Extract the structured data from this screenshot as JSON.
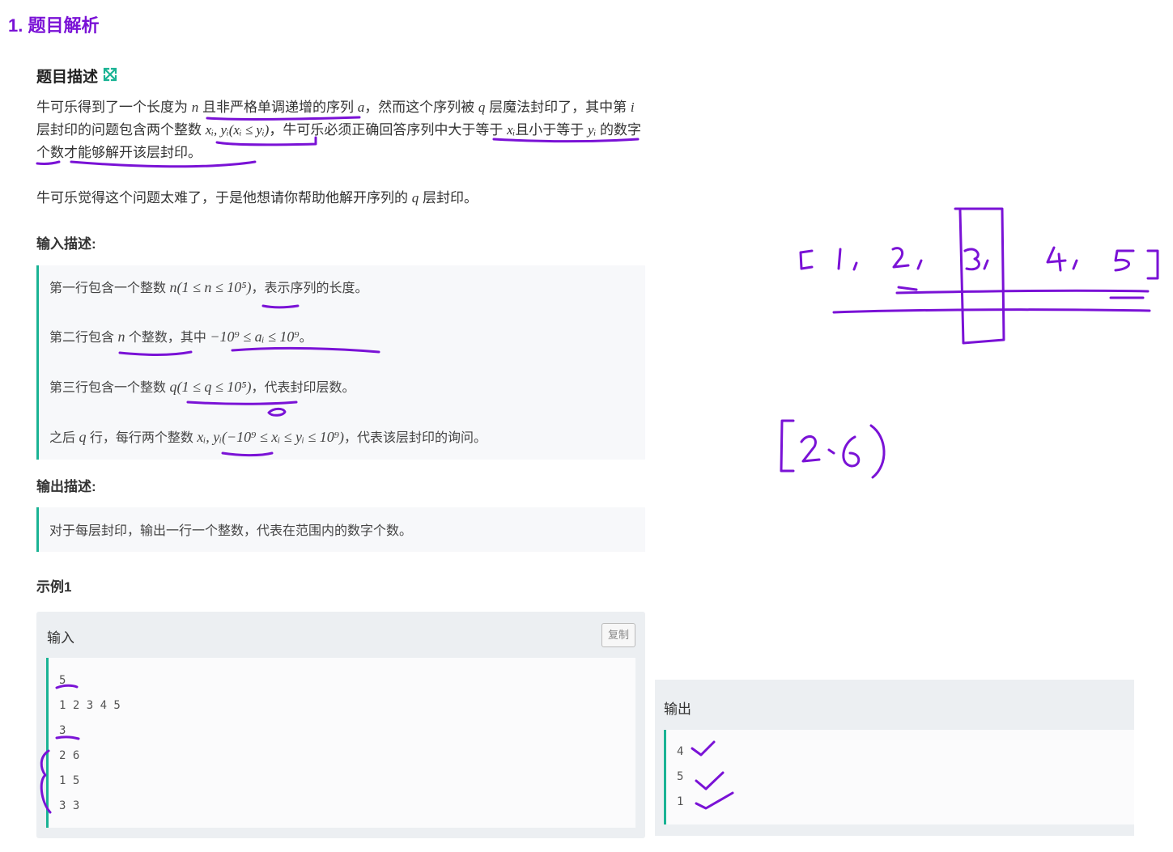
{
  "section_title": "1. 题目解析",
  "description": {
    "heading": "题目描述",
    "para1": [
      [
        "t",
        "牛可乐得到了一个长度为 "
      ],
      [
        "m",
        "n"
      ],
      [
        "t",
        " 且非严格单调递增的序列 "
      ],
      [
        "m",
        "a"
      ],
      [
        "t",
        "，然而这个序列被 "
      ],
      [
        "m",
        "q"
      ],
      [
        "t",
        " 层魔法封印了，其中第 "
      ],
      [
        "m",
        "i"
      ],
      [
        "t",
        " 层封印的问题包含两个整数 "
      ],
      [
        "m",
        "xᵢ, yᵢ(xᵢ ≤ yᵢ)"
      ],
      [
        "t",
        "，牛可乐必须正确回答序列中大于等于 "
      ],
      [
        "m",
        "xᵢ"
      ],
      [
        "t",
        "且小于等于 "
      ],
      [
        "m",
        "yᵢ"
      ],
      [
        "t",
        " 的数字个数才能够解开该层封印。"
      ]
    ],
    "para2": [
      [
        "t",
        "牛可乐觉得这个问题太难了，于是他想请你帮助他解开序列的 "
      ],
      [
        "m",
        "q"
      ],
      [
        "t",
        " 层封印。"
      ]
    ]
  },
  "input_section": {
    "heading": "输入描述:",
    "lines": [
      [
        [
          "t",
          "第一行包含一个整数  "
        ],
        [
          "m",
          "n(1 ≤ n ≤ 10⁵)"
        ],
        [
          "t",
          "，表示序列的长度。"
        ]
      ],
      [
        [
          "t",
          "第二行包含  "
        ],
        [
          "m",
          "n"
        ],
        [
          "t",
          "  个整数，其中  "
        ],
        [
          "m",
          "−10⁹ ≤ aᵢ ≤ 10⁹"
        ],
        [
          "t",
          "。"
        ]
      ],
      [
        [
          "t",
          "第三行包含一个整数  "
        ],
        [
          "m",
          "q(1 ≤ q ≤ 10⁵)"
        ],
        [
          "t",
          "，代表封印层数。"
        ]
      ],
      [
        [
          "t",
          "之后  "
        ],
        [
          "m",
          "q"
        ],
        [
          "t",
          "  行，每行两个整数  "
        ],
        [
          "m",
          "xᵢ, yᵢ(−10⁹ ≤ xᵢ ≤ yᵢ ≤ 10⁹)"
        ],
        [
          "t",
          "，代表该层封印的询问。"
        ]
      ]
    ]
  },
  "output_section": {
    "heading": "输出描述:",
    "text": "对于每层封印，输出一行一个整数，代表在范围内的数字个数。"
  },
  "example": {
    "heading": "示例1",
    "input_label": "输入",
    "copy_label": "复制",
    "input_lines": [
      "5",
      "1 2 3 4 5",
      "3",
      "2 6",
      "1 5",
      "3 3"
    ],
    "output_label": "输出",
    "output_lines": [
      "4",
      "5",
      "1"
    ]
  },
  "annotations": {
    "color": "#7a12d6",
    "sketch_array": "[1, 2, 3, 4, 5]",
    "sketch_query": "[2,6)"
  }
}
